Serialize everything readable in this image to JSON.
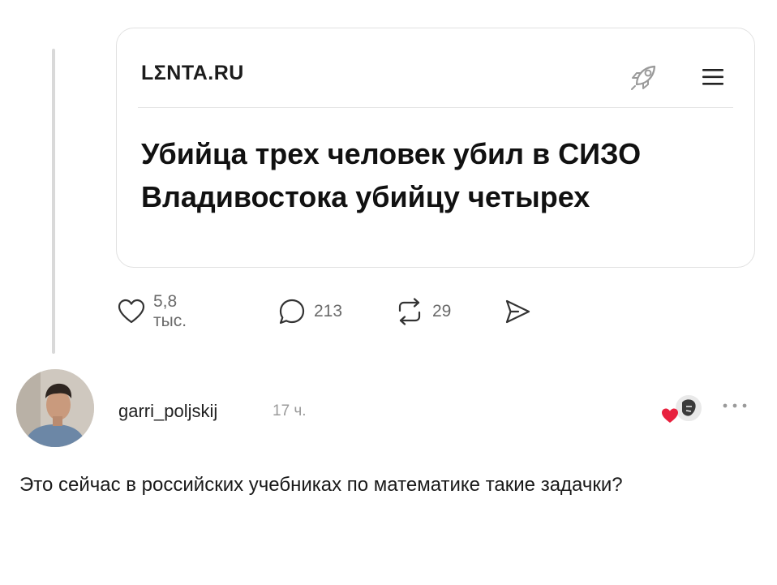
{
  "quoted_post": {
    "source_logo": "LΣNTA.RU",
    "headline": "Убийца трех человек убил в СИЗО Владивостока убийцу четырех",
    "icons": [
      "rocket-icon",
      "hamburger-menu-icon"
    ]
  },
  "actions": {
    "likes": "5,8 тыс.",
    "comments": "213",
    "reposts": "29",
    "icons": [
      "heart-icon",
      "comment-bubble-icon",
      "repost-icon",
      "share-icon"
    ]
  },
  "reply": {
    "username": "garri_poljskij",
    "time": "17 ч.",
    "text": "Это сейчас в российских учебниках по математике такие задачки?",
    "accent_color": "#e8213e"
  }
}
